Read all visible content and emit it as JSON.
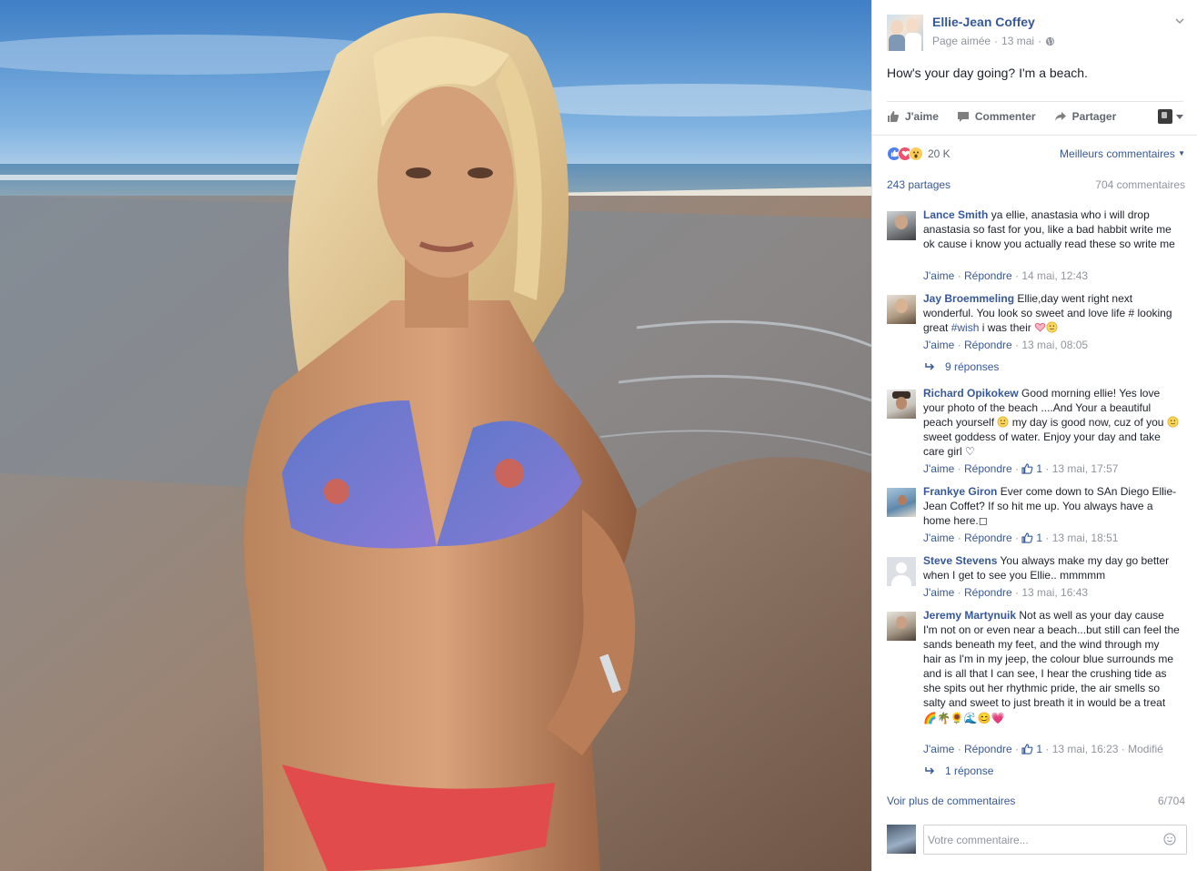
{
  "post": {
    "page_name": "Ellie-Jean Coffey",
    "page_status": "Page aimée",
    "date": "13 mai",
    "text": "How's your day going? I'm a beach."
  },
  "actions": {
    "like": "J'aime",
    "comment": "Commenter",
    "share": "Partager"
  },
  "reactions": {
    "icons": [
      "like-reaction",
      "love-reaction",
      "wow-reaction"
    ],
    "count": "20 K",
    "sort_label": "Meilleurs commentaires"
  },
  "stats": {
    "shares": "243 partages",
    "comments": "704 commentaires"
  },
  "comments": [
    {
      "author": "Lance Smith",
      "text": " ya ellie, anastasia who i will drop anastasia so fast for you, like a bad habbit write me ok cause i know you actually read these so write me",
      "like": "J'aime",
      "reply": "Répondre",
      "time": "14 mai, 12:43"
    },
    {
      "author": "Jay Broemmeling",
      "text_1": " Ellie,day went right next wonderful. You look so sweet and love life # looking great ",
      "hashtag": "#wish",
      "text_2": " i was their ",
      "like": "J'aime",
      "reply": "Répondre",
      "time": "13 mai, 08:05",
      "replies": "9 réponses"
    },
    {
      "author": "Richard Opikokew",
      "text_1": " Good morning ellie! Yes love your photo of the beach ....And Your a beautiful peach yourself ",
      "text_2": " my day is good now, cuz of you ",
      "text_3": " sweet goddess of water. Enjoy your day and take care girl ♡",
      "like": "J'aime",
      "reply": "Répondre",
      "reactions": "1",
      "time": "13 mai, 17:57"
    },
    {
      "author": "Frankye Giron",
      "text": " Ever come down to SAn Diego Ellie-Jean Coffet? If so hit me up. You always have a home here.◻",
      "like": "J'aime",
      "reply": "Répondre",
      "reactions": "1",
      "time": "13 mai, 18:51"
    },
    {
      "author": "Steve Stevens",
      "text": " You always make my day go better when I get to see you Ellie.. mmmmm",
      "like": "J'aime",
      "reply": "Répondre",
      "time": "13 mai, 16:43"
    },
    {
      "author": "Jeremy Martynuik",
      "text": " Not as well as your day cause I'm not on or even near a beach...but still can feel the sands beneath my feet, and the wind through my hair as I'm in my jeep, the colour blue surrounds me and is all that I can see, I hear the crushing tide as she spits out her rhythmic pride, the air smells so salty and sweet to just breath it in would be a treat",
      "emoji_row": "🌈🌴🌻🌊😊💗",
      "like": "J'aime",
      "reply": "Répondre",
      "reactions": "1",
      "time": "13 mai, 16:23",
      "edited": "Modifié",
      "replies": "1 réponse"
    }
  ],
  "footer": {
    "more_comments": "Voir plus de commentaires",
    "page_indicator": "6/704",
    "placeholder": "Votre commentaire..."
  },
  "colors": {
    "link": "#365899",
    "muted": "#90949c",
    "like_blue": "#4e81ee",
    "love_red": "#f0506e",
    "wow_yellow": "#fbcd58"
  }
}
